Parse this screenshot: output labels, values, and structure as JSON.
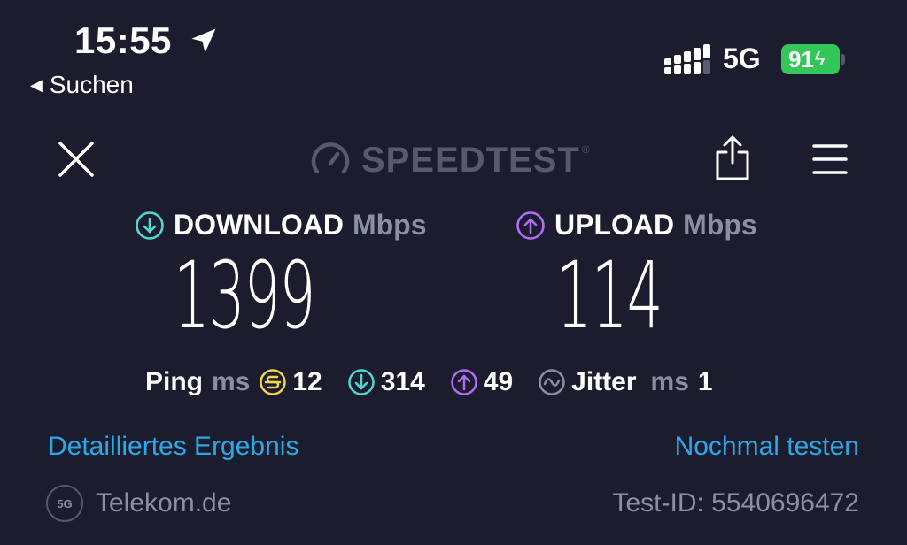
{
  "status_bar": {
    "time": "15:55",
    "back_label": "Suchen",
    "network": "5G",
    "battery": "91",
    "location_icon": "location-arrow-icon",
    "signal_icon": "cellular-signal-icon",
    "battery_color": "#33c659"
  },
  "header": {
    "brand": "SPEEDTEST",
    "brand_tm": "®",
    "close_icon": "close-icon",
    "share_icon": "share-icon",
    "menu_icon": "hamburger-menu-icon"
  },
  "download": {
    "label": "DOWNLOAD",
    "unit": "Mbps",
    "value": "1399",
    "color": "#4fd8d0"
  },
  "upload": {
    "label": "UPLOAD",
    "unit": "Mbps",
    "value": "114",
    "color": "#b26bf5"
  },
  "ping": {
    "label": "Ping",
    "unit": "ms",
    "idle": "12",
    "download": "314",
    "upload": "49",
    "idle_color": "#f2d44a"
  },
  "jitter": {
    "label": "Jitter",
    "unit": "ms",
    "value": "1"
  },
  "actions": {
    "details": "Detailliertes Ergebnis",
    "retest": "Nochmal testen"
  },
  "footer": {
    "provider_badge": "5G",
    "provider": "Telekom.de",
    "test_id": "Test-ID: 5540696472"
  }
}
